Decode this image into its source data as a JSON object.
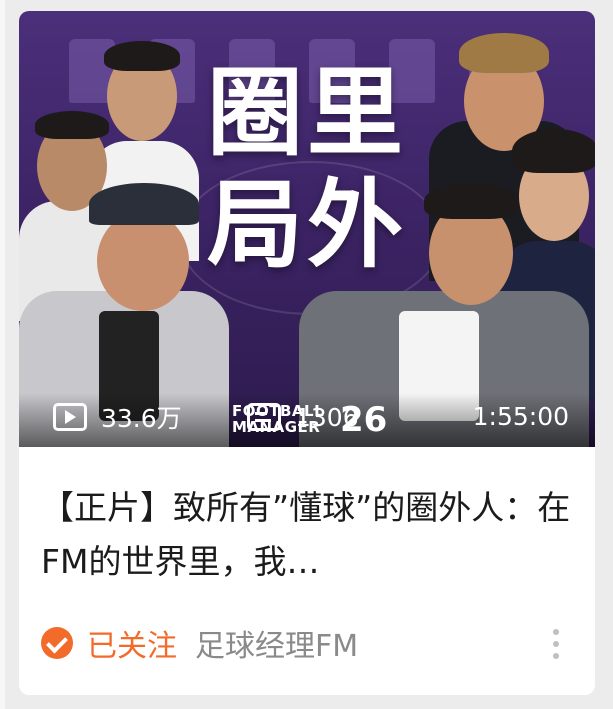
{
  "thumbnail": {
    "title_line1": "圈里",
    "title_line2": "局外",
    "views": "33.6万",
    "danmaku": "1306",
    "duration": "1:55:00",
    "logo_line1": "FOOTBALL",
    "logo_line2": "MANAGER",
    "logo_number": "26"
  },
  "video": {
    "title": "【正片】致所有”懂球”的圈外人：在FM的世界里，我…"
  },
  "meta": {
    "follow_status": "已关注",
    "channel_name": "足球经理FM"
  },
  "colors": {
    "accent": "#f26b2a",
    "thumbnail_bg": "#3d2466"
  },
  "icons": [
    "play-count-icon",
    "danmaku-icon",
    "followed-check-icon",
    "more-icon"
  ]
}
